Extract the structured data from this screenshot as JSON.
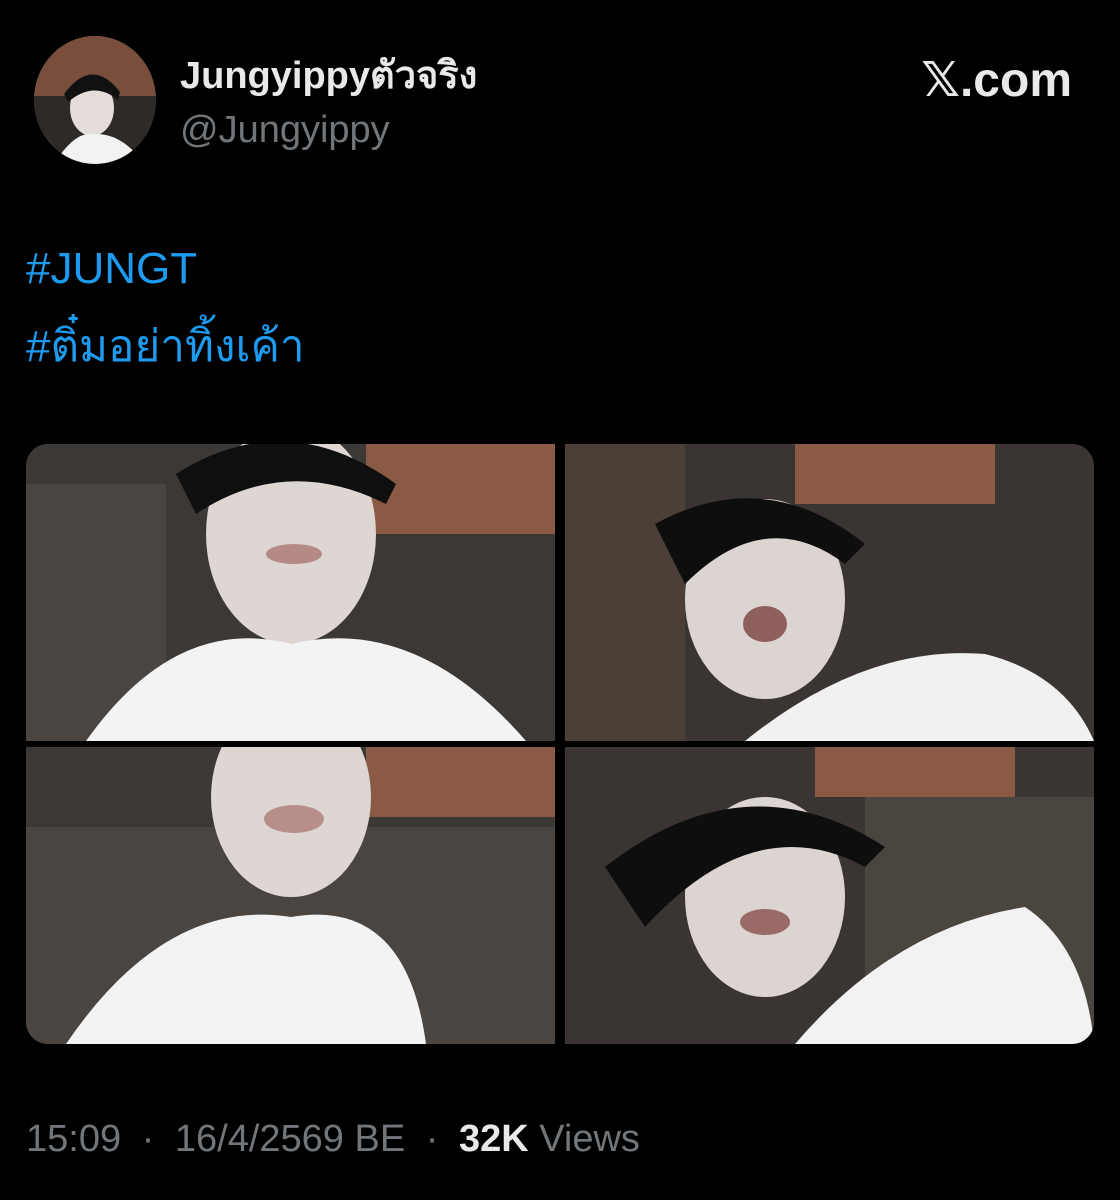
{
  "author": {
    "display_name": "Jungyippyตัวจริง",
    "handle": "@Jungyippy",
    "avatar_icon": "profile-photo"
  },
  "brand": {
    "label": "𝕏.com"
  },
  "post": {
    "hashtags": [
      "#JUNGT",
      "#ติ๋มอย่าทิ้งเค้า"
    ],
    "media": [
      {
        "description_icon": "selfie-photo-1"
      },
      {
        "description_icon": "selfie-photo-2"
      },
      {
        "description_icon": "selfie-photo-3"
      },
      {
        "description_icon": "selfie-photo-4"
      }
    ]
  },
  "meta": {
    "time": "15:09",
    "date": "16/4/2569 BE",
    "separator": "·",
    "views_count": "32K",
    "views_label": "Views"
  },
  "colors": {
    "background": "#000000",
    "primary_text": "#e7e9ea",
    "secondary_text": "#71767b",
    "hashtag": "#1d9bf0"
  }
}
